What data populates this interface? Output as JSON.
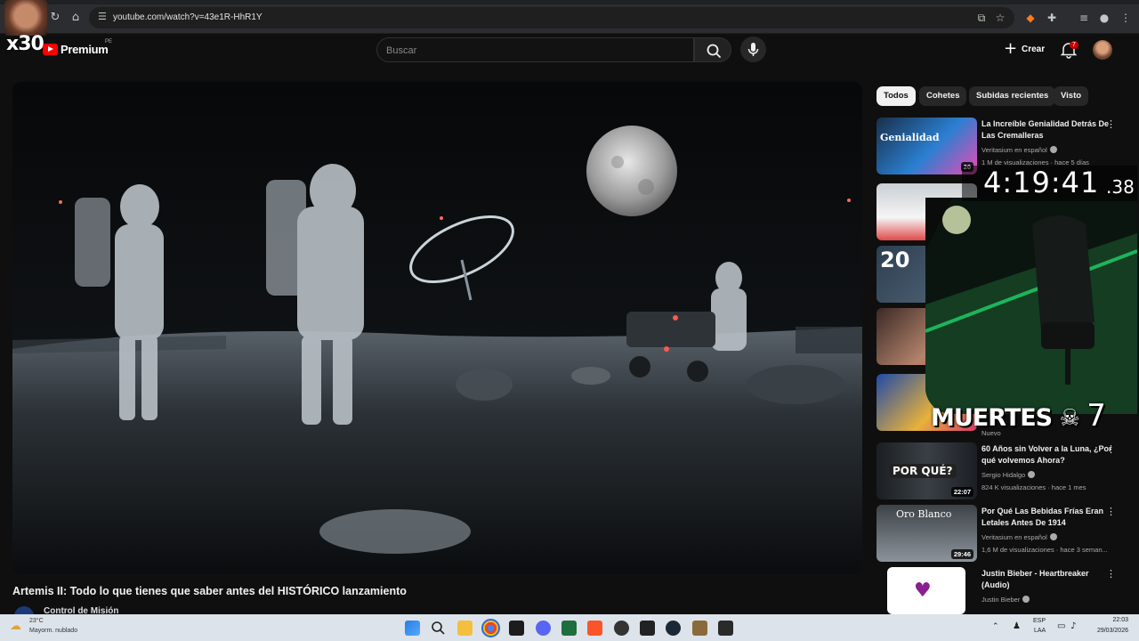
{
  "browser": {
    "url": "youtube.com/watch?v=43e1R-HhR1Y"
  },
  "overlay": {
    "counter_label": "x30",
    "timer_main": "4:19:41",
    "timer_ms": ".38",
    "deaths_label": "MUERTES",
    "deaths_count": "7"
  },
  "header": {
    "logo_word": "Premium",
    "logo_region": "PE",
    "search_placeholder": "Buscar",
    "create_label": "Crear",
    "notifications_count": "7"
  },
  "video": {
    "title": "Artemis II: Todo lo que tienes que saber antes del HISTÓRICO lanzamiento",
    "channel": "Control de Misión"
  },
  "chips": [
    "Todos",
    "Cohetes",
    "Subidas recientes",
    "Visto"
  ],
  "recommendations": [
    {
      "title": "La Increíble Genialidad Detrás De Las Cremalleras",
      "channel": "Veritasium en español",
      "meta": "1 M de visualizaciones · hace 5 días",
      "thumb_text": "Genialidad",
      "duration": "20"
    },
    {
      "title": "",
      "channel": "",
      "meta": "",
      "thumb_text": "",
      "duration": ""
    },
    {
      "title": "",
      "channel": "",
      "meta": "",
      "thumb_text": "20",
      "duration": ""
    },
    {
      "title": "",
      "channel": "",
      "meta": "",
      "thumb_text": "",
      "duration": ""
    },
    {
      "title": "",
      "channel": "",
      "meta": "Nuevo",
      "thumb_text": "",
      "duration": ""
    },
    {
      "title": "60 Años sin Volver a la Luna, ¿Por qué volvemos Ahora?",
      "channel": "Sergio Hidalgo",
      "meta": "824 K visualizaciones · hace 1 mes",
      "thumb_text": "POR QUÉ?",
      "duration": "22:07"
    },
    {
      "title": "Por Qué Las Bebidas Frías Eran Letales Antes De 1914",
      "channel": "Veritasium en español",
      "meta": "1,6 M de visualizaciones · hace 3 seman...",
      "thumb_text": "Oro Blanco",
      "duration": "29:46"
    },
    {
      "title": "Justin Bieber - Heartbreaker (Audio)",
      "channel": "Justin Bieber",
      "meta": "",
      "thumb_text": "",
      "duration": ""
    }
  ],
  "taskbar": {
    "weather_temp": "23°C",
    "weather_cond": "Mayorm. nublado",
    "lang": "ESP",
    "lang_sub": "LAA",
    "time": "22:03",
    "date": "29/03/2026"
  },
  "colors": {
    "youtube_red": "#ff0000",
    "background": "#0f0f0f",
    "chip_active": "#f1f1f1",
    "webcam_green": "#1fd36a"
  }
}
